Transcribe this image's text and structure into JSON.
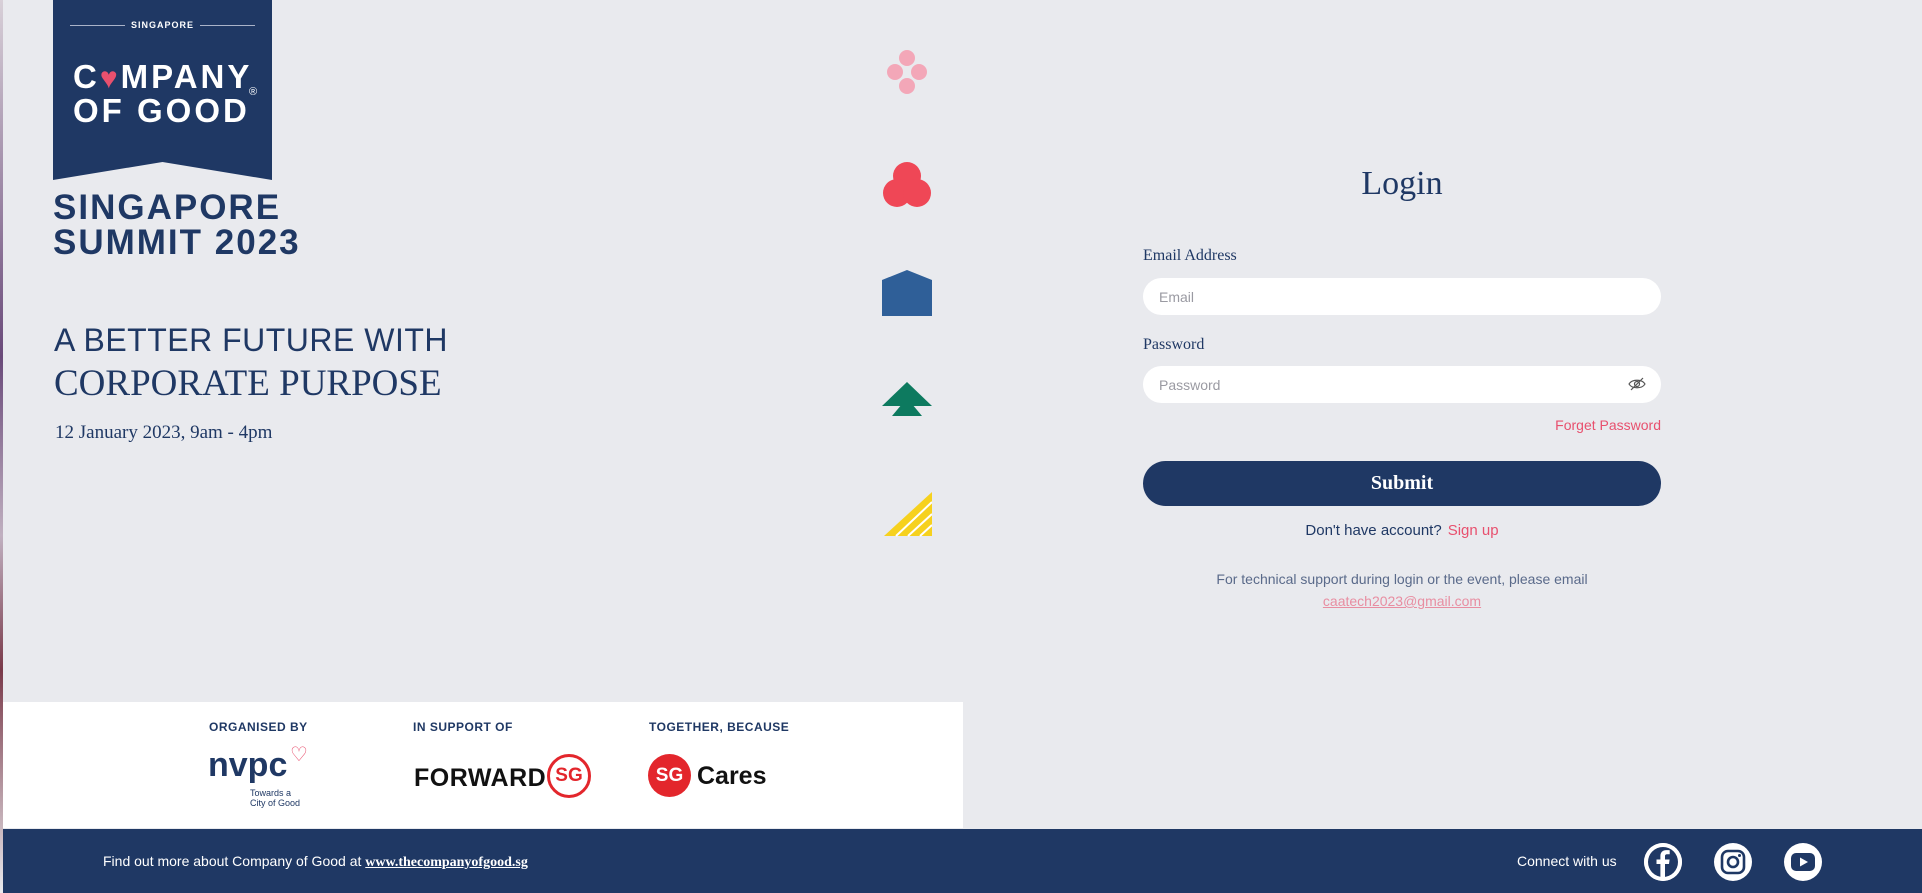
{
  "logo": {
    "top_label": "SINGAPORE",
    "line1_a": "C",
    "line1_b": "MPANY",
    "line2": "OF GOOD",
    "reg_mark": "®",
    "event_line1": "SINGAPORE",
    "event_line2": "SUMMIT 2023"
  },
  "hero": {
    "headline1": "A BETTER FUTURE WITH",
    "headline2": "CORPORATE PURPOSE",
    "date": "12 January 2023, 9am - 4pm"
  },
  "login": {
    "title": "Login",
    "email_label": "Email Address",
    "email_placeholder": "Email",
    "email_value": "",
    "password_label": "Password",
    "password_placeholder": "Password",
    "password_value": "",
    "forget_password": "Forget Password",
    "submit": "Submit",
    "no_account": "Don't have account?",
    "sign_up": "Sign up",
    "support_text": "For technical support during login or the event, please email",
    "support_email": "caatech2023@gmail.com"
  },
  "partners": {
    "organised_by": "ORGANISED BY",
    "in_support_of": "IN SUPPORT OF",
    "together_because": "TOGETHER, BECAUSE",
    "nvpc": "nvpc",
    "nvpc_tag1": "Towards a",
    "nvpc_tag2": "City of Good",
    "forward": "FORWARD",
    "sg": "SG",
    "cares": "Cares"
  },
  "footer": {
    "find_out": "Find out more about Company of Good at ",
    "site_link": "www.thecompanyofgood.sg",
    "connect": "Connect with us",
    "social_icons": [
      "facebook-icon",
      "instagram-icon",
      "youtube-icon"
    ]
  },
  "colors": {
    "navy": "#1f3864",
    "accent_pink": "#e8506e",
    "sg_red": "#e3262c",
    "background": "#e9eaee"
  }
}
